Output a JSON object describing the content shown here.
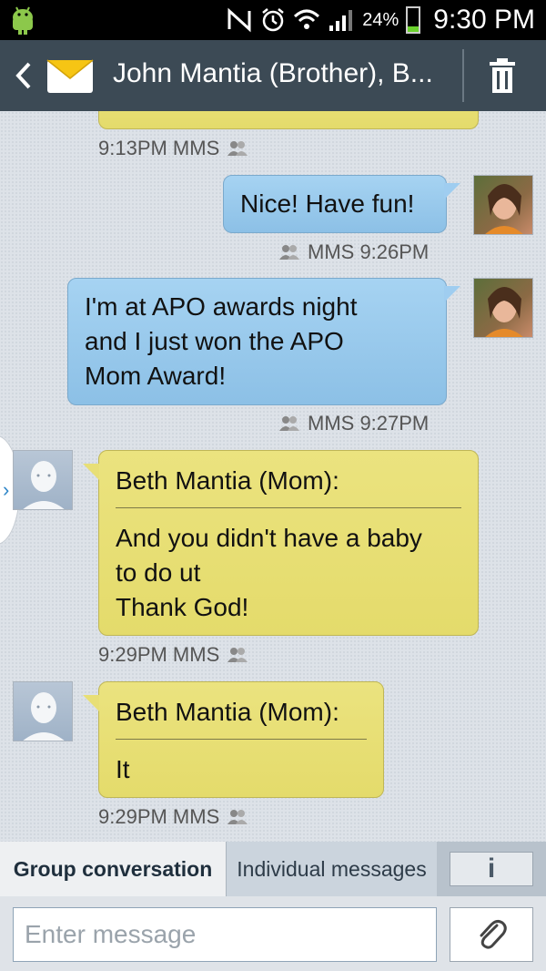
{
  "status_bar": {
    "battery_percent": "24%",
    "time": "9:30 PM"
  },
  "header": {
    "title": "John Mantia (Brother), B..."
  },
  "messages": [
    {
      "type": "in_partial",
      "meta": "9:13PM MMS"
    },
    {
      "type": "out",
      "text": "Nice! Have fun!",
      "meta": "MMS 9:26PM"
    },
    {
      "type": "out",
      "lines": [
        "I'm at APO awards night",
        "and I just won the APO",
        "Mom Award!"
      ],
      "meta": "MMS 9:27PM"
    },
    {
      "type": "in",
      "sender": "Beth Mantia (Mom):",
      "lines": [
        "And you didn't have a baby",
        "to do ut",
        "Thank God!"
      ],
      "meta": "9:29PM MMS"
    },
    {
      "type": "in",
      "sender": "Beth Mantia (Mom):",
      "lines": [
        "It"
      ],
      "meta": "9:29PM MMS"
    }
  ],
  "tabs": {
    "group": "Group conversation",
    "individual": "Individual messages",
    "info": "i"
  },
  "composer": {
    "placeholder": "Enter message"
  },
  "colors": {
    "header_bg": "#3c4a55",
    "outgoing_bubble": "#9fcdf0",
    "incoming_bubble": "#e8df76",
    "battery_green": "#6bd22d"
  }
}
